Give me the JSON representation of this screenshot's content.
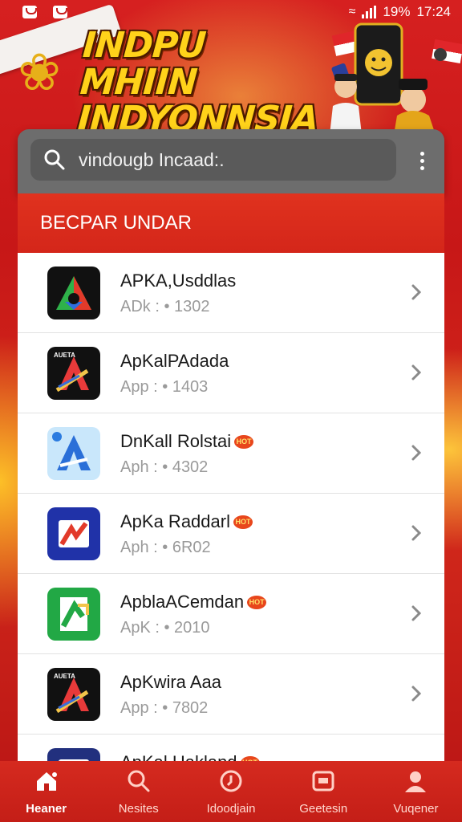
{
  "status_bar": {
    "battery": "19%",
    "time": "17:24"
  },
  "banner": {
    "headline_line1": "INDPU MHIIN",
    "headline_line2": "INDYONNSIA"
  },
  "search": {
    "value": "vindougb Incaad:.",
    "icon": "search-icon",
    "menu_icon": "more-vert-icon"
  },
  "section": {
    "title": "BECPAR UNDAR"
  },
  "apps": [
    {
      "name": "APKA,Usddlas",
      "meta": "ADk : • 1302",
      "hot": false,
      "icon": "dark-a-logo-icon"
    },
    {
      "name": "ApKalPAdada",
      "meta": "App : • 1403",
      "hot": false,
      "icon": "meta-a-logo-icon"
    },
    {
      "name": "DnKall Rolstai",
      "meta": "Aph : • 4302",
      "hot": true,
      "badge": "HOT",
      "icon": "blue-a-logo-icon"
    },
    {
      "name": "ApKa Raddarl",
      "meta": "Aph : • 6R02",
      "hot": true,
      "badge": "HOT",
      "icon": "navy-arrow-logo-icon"
    },
    {
      "name": "ApblaACemdan",
      "meta": "ApK : • 2010",
      "hot": true,
      "badge": "HOT",
      "icon": "green-arrow-logo-icon"
    },
    {
      "name": "ApKwira Aaa",
      "meta": "App : • 7802",
      "hot": false,
      "icon": "meta-a-logo-icon"
    },
    {
      "name": "ApKal Hakland",
      "meta": "",
      "hot": true,
      "badge": "HOT",
      "icon": "navy-logo-icon"
    }
  ],
  "bottom_nav": [
    {
      "label": "Heaner",
      "icon": "home-icon",
      "active": true
    },
    {
      "label": "Nesites",
      "icon": "search-icon",
      "active": false
    },
    {
      "label": "Idoodjain",
      "icon": "clock-icon",
      "active": false
    },
    {
      "label": "Geetesin",
      "icon": "window-icon",
      "active": false
    },
    {
      "label": "Vuqener",
      "icon": "user-icon",
      "active": false
    }
  ],
  "colors": {
    "brand_red": "#d4261a",
    "headline_yellow": "#ffd21a"
  }
}
